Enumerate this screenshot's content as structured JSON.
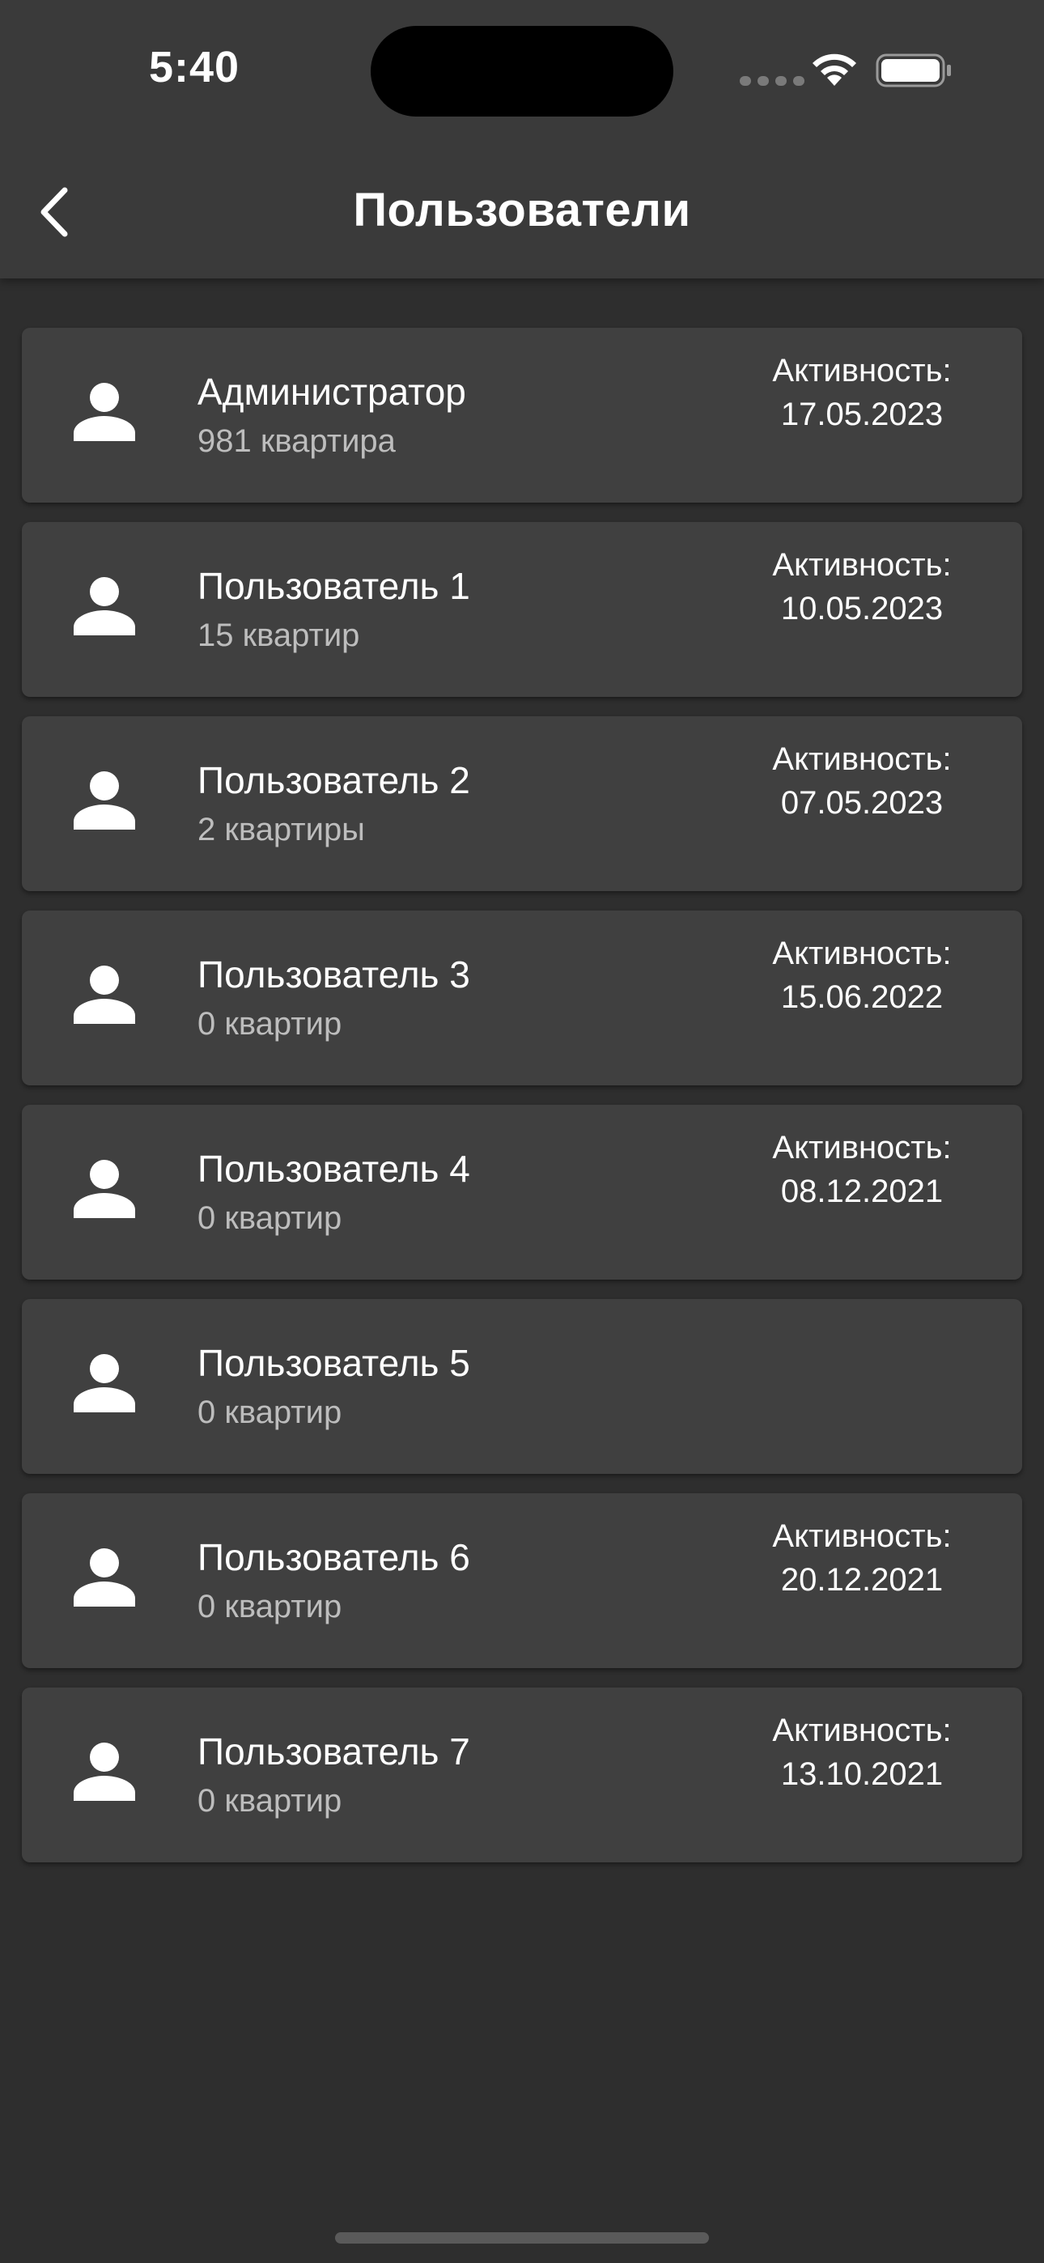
{
  "status_bar": {
    "time": "5:40"
  },
  "header": {
    "title": "Пользователи",
    "back_icon": "chevron-left-icon"
  },
  "users": [
    {
      "name": "Администратор",
      "sub": "981 квартира",
      "activity_label": "Активность:",
      "activity_date": "17.05.2023"
    },
    {
      "name": "Пользователь 1",
      "sub": "15 квартир",
      "activity_label": "Активность:",
      "activity_date": "10.05.2023"
    },
    {
      "name": "Пользователь 2",
      "sub": "2 квартиры",
      "activity_label": "Активность:",
      "activity_date": "07.05.2023"
    },
    {
      "name": "Пользователь 3",
      "sub": "0 квартир",
      "activity_label": "Активность:",
      "activity_date": "15.06.2022"
    },
    {
      "name": "Пользователь 4",
      "sub": "0 квартир",
      "activity_label": "Активность:",
      "activity_date": "08.12.2021"
    },
    {
      "name": "Пользователь 5",
      "sub": "0 квартир",
      "activity_label": "",
      "activity_date": ""
    },
    {
      "name": "Пользователь 6",
      "sub": "0 квартир",
      "activity_label": "Активность:",
      "activity_date": "20.12.2021"
    },
    {
      "name": "Пользователь 7",
      "sub": "0 квартир",
      "activity_label": "Активность:",
      "activity_date": "13.10.2021"
    }
  ],
  "colors": {
    "background": "#2e2e2e",
    "header": "#3a3a3a",
    "card": "#404040",
    "text_primary": "#ffffff",
    "text_secondary": "#bdbdbd"
  }
}
